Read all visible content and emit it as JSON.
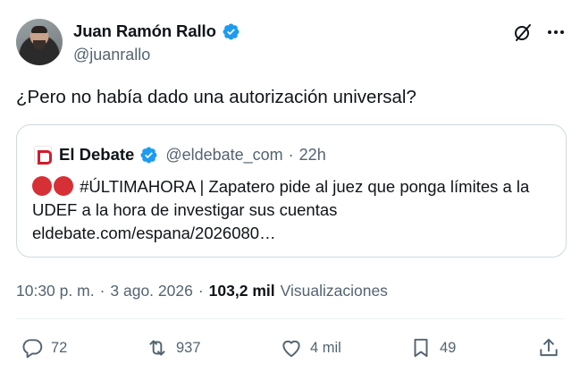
{
  "author": {
    "display_name": "Juan Ramón Rallo",
    "handle": "@juanrallo"
  },
  "tweet": {
    "text": "¿Pero no había dado una autorización universal?"
  },
  "quote": {
    "display_name": "El Debate",
    "handle": "@eldebate_com",
    "separator": "·",
    "time": "22h",
    "text_hashtag": "#ÚLTIMAHORA | Zapatero pide al juez que ponga límites a la UDEF a la hora de investigar sus cuentas",
    "link": "eldebate.com/espana/2026080…"
  },
  "meta": {
    "time": "10:30 p. m.",
    "separator": "·",
    "date": "3 ago. 2026",
    "separator2": "·",
    "views_count": "103,2 mil",
    "views_label": "Visualizaciones"
  },
  "actions": {
    "replies": "72",
    "reposts": "937",
    "likes": "4 mil",
    "bookmarks": "49"
  },
  "colors": {
    "verified_blue": "#1d9bf0",
    "text_primary": "#0f1419",
    "text_secondary": "#536471",
    "border": "#cfd9de",
    "brand_red": "#d21b2b"
  },
  "icons": [
    "verified-badge-icon",
    "grok-icon",
    "more-icon",
    "reply-icon",
    "repost-icon",
    "like-icon",
    "bookmark-icon",
    "share-icon",
    "el-debate-logo-icon"
  ]
}
